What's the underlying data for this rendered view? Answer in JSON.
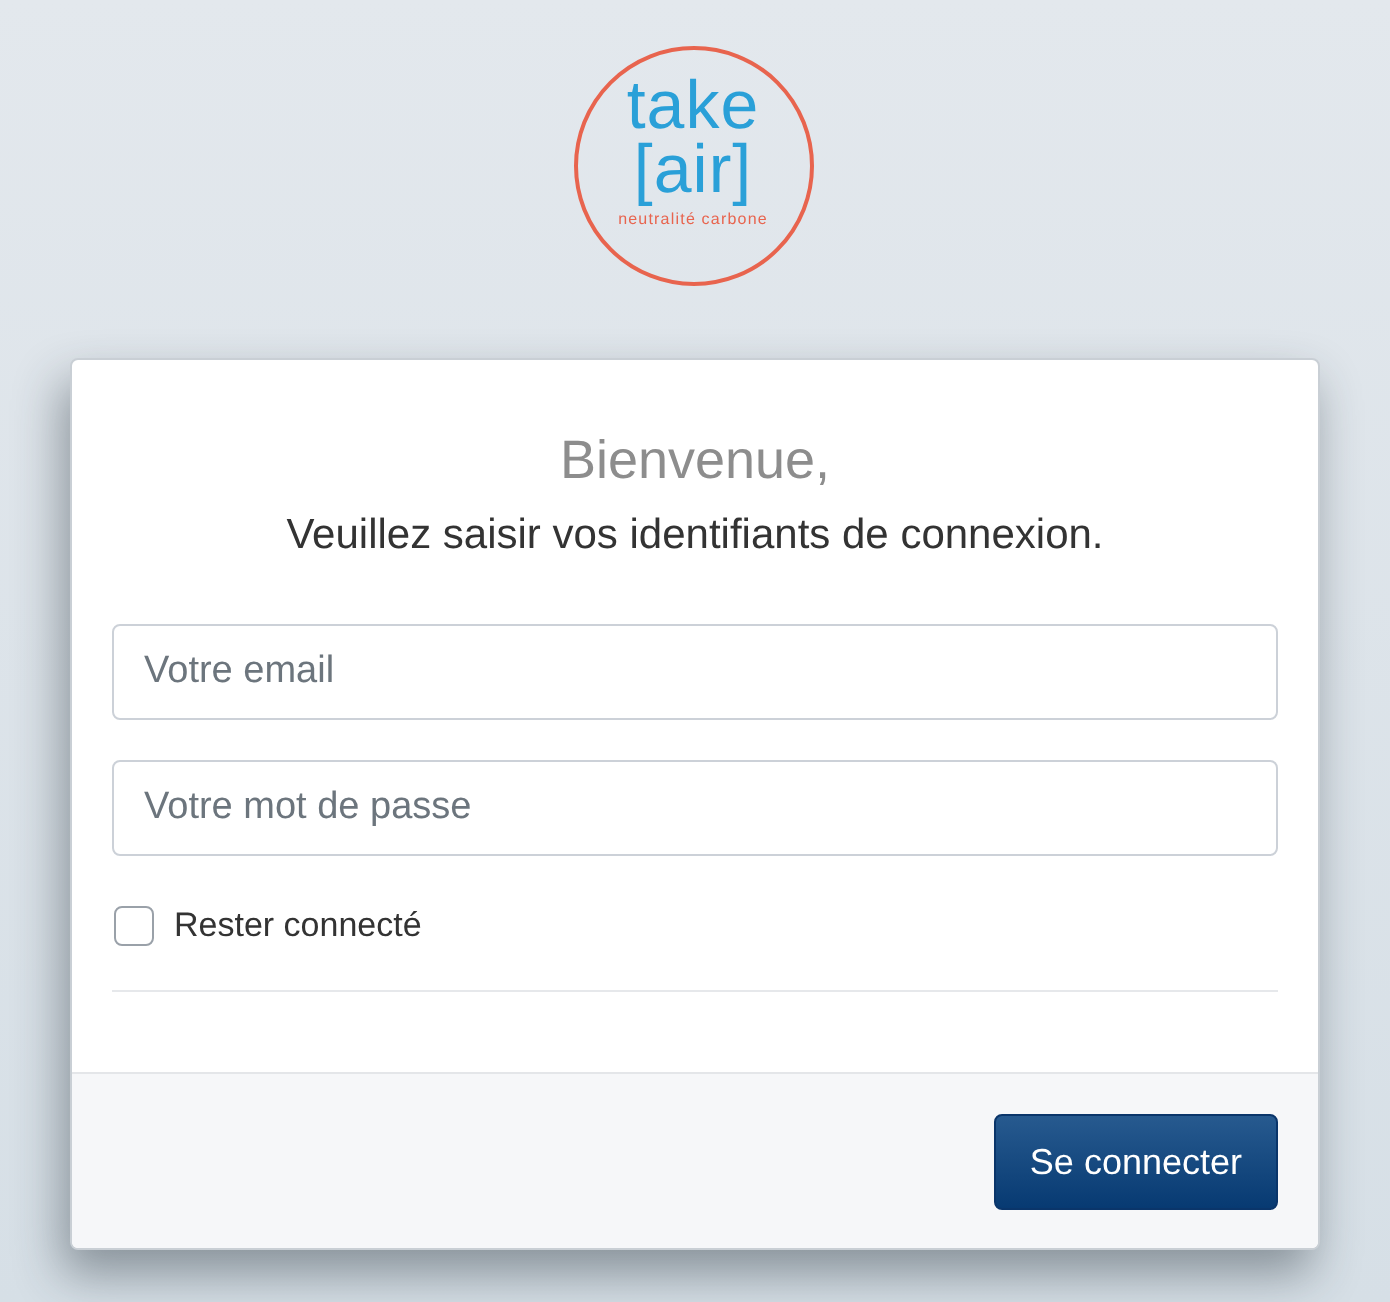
{
  "logo": {
    "word": "take",
    "bracket_word": "[air]",
    "tagline": "neutralité carbone"
  },
  "card": {
    "title": "Bienvenue,",
    "subtitle": "Veuillez saisir vos identifiants de connexion."
  },
  "fields": [
    {
      "placeholder": "Votre email"
    },
    {
      "placeholder": "Votre mot de passe"
    }
  ],
  "remember": {
    "label": "Rester connecté",
    "checked": false
  },
  "submit_button": {
    "label": "Se connecter"
  }
}
